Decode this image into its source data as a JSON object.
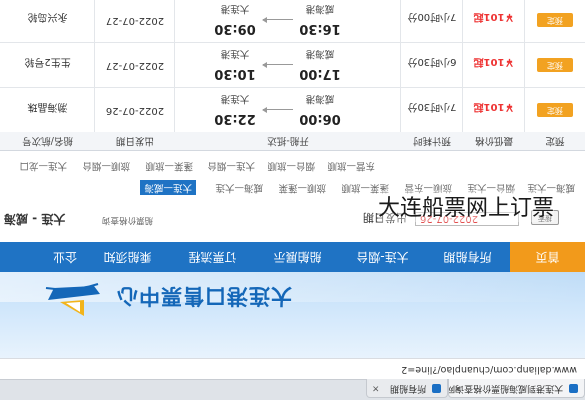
{
  "browser": {
    "tabs": [
      {
        "title": "大连港到威海船票价格查询网",
        "close": "×"
      },
      {
        "title": "所有船期",
        "close": "×"
      }
    ],
    "url": "www.dalianp.com/chuanplao/?line=2"
  },
  "header": {
    "title": "大连港口售票中心"
  },
  "nav": [
    {
      "label": "首页",
      "active": true
    },
    {
      "label": "所有船期",
      "active": false
    },
    {
      "label": "大连-烟台",
      "active": false
    },
    {
      "label": "船舶展示",
      "active": false
    },
    {
      "label": "订票流程",
      "active": false
    },
    {
      "label": "乘船须知",
      "active": false
    },
    {
      "label": "企业",
      "active": false
    }
  ],
  "search": {
    "route_title": "大连 - 威海",
    "route_subtitle": "船票价格查询",
    "date_label": "出发日期",
    "date_value": "2022-07-26",
    "button_label": "搜索"
  },
  "routes": {
    "row1": [
      {
        "label": "大连—威海",
        "active": true
      },
      {
        "label": "威海—大连",
        "active": false
      },
      {
        "label": "旅顺—蓬莱",
        "active": false
      },
      {
        "label": "蓬莱—旅顺",
        "active": false
      },
      {
        "label": "旅顺—东营",
        "active": false
      },
      {
        "label": "烟台—大连",
        "active": false
      },
      {
        "label": "威海—大连",
        "active": false
      }
    ],
    "row2": [
      {
        "label": "大连—龙口",
        "active": false
      },
      {
        "label": "旅顺—烟台",
        "active": false
      },
      {
        "label": "蓬莱—旅顺",
        "active": false
      },
      {
        "label": "大连—烟台",
        "active": false
      },
      {
        "label": "烟台—旅顺",
        "active": false
      },
      {
        "label": "东营—旅顺",
        "active": false
      }
    ]
  },
  "table": {
    "headers": [
      "船名/航次号",
      "出发日期",
      "开船-抵达",
      "预计耗时",
      "最低价格",
      "预定"
    ],
    "rows": [
      {
        "ship": "渤海晶珠",
        "date": "2022-07-26",
        "dep_time": "22:30",
        "dep_port": "大连港",
        "arr_time": "06:00",
        "arr_port": "威海港",
        "duration": "7小时30分",
        "price": "￥101起",
        "book": "预定"
      },
      {
        "ship": "生生2号轮",
        "date": "2022-07-27",
        "dep_time": "10:30",
        "dep_port": "大连港",
        "arr_time": "17:00",
        "arr_port": "威海港",
        "duration": "6小时30分",
        "price": "￥101起",
        "book": "预定"
      },
      {
        "ship": "永兴岛轮",
        "date": "2022-07-27",
        "dep_time": "09:30",
        "dep_port": "大连港",
        "arr_time": "16:30",
        "arr_port": "威海港",
        "duration": "7小时00分",
        "price": "￥101起",
        "book": "预定"
      }
    ]
  },
  "overlay": {
    "caption": "大连船票网上订票"
  }
}
